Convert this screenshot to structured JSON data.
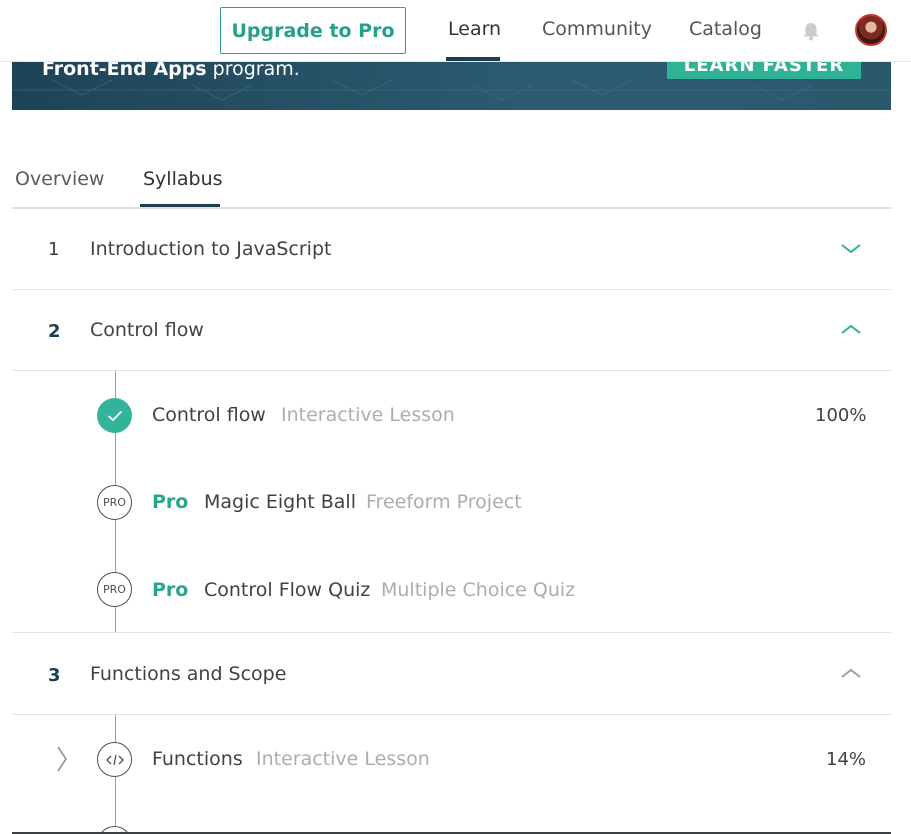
{
  "nav": {
    "upgrade_label": "Upgrade to Pro",
    "links": [
      "Learn",
      "Community",
      "Catalog"
    ],
    "active_link": "Learn"
  },
  "banner": {
    "text_bold": "Front-End Apps",
    "text_rest": " program.",
    "button_label": "LEARN FASTER"
  },
  "tabs": {
    "overview": "Overview",
    "syllabus": "Syllabus",
    "active": "Syllabus"
  },
  "sections": [
    {
      "number": "1",
      "title": "Introduction to JavaScript",
      "expanded": false
    },
    {
      "number": "2",
      "title": "Control flow",
      "expanded": true,
      "lessons": [
        {
          "title": "Control flow",
          "type": "Interactive Lesson",
          "progress": "100%",
          "status": "complete",
          "pro": false
        },
        {
          "title": "Magic Eight Ball",
          "type": "Freeform Project",
          "status": "pro",
          "pro": true,
          "pro_label": "Pro",
          "icon_text": "PRO"
        },
        {
          "title": "Control Flow Quiz",
          "type": "Multiple Choice Quiz",
          "status": "pro",
          "pro": true,
          "pro_label": "Pro",
          "icon_text": "PRO"
        }
      ]
    },
    {
      "number": "3",
      "title": "Functions and Scope",
      "expanded": true,
      "lessons": [
        {
          "title": "Functions",
          "type": "Interactive Lesson",
          "progress": "14%",
          "status": "in-progress",
          "pro": false
        }
      ]
    }
  ],
  "colors": {
    "accent": "#2fb295",
    "navy": "#1d3e4e",
    "muted_text": "#a9aeb2"
  }
}
